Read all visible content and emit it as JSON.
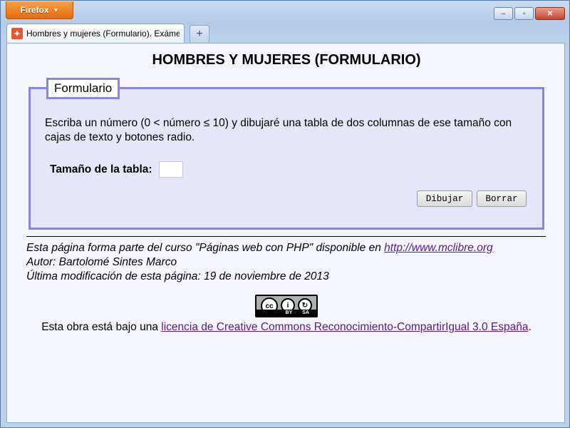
{
  "browser": {
    "menu_button": "Firefox",
    "tab_title": "Hombres y mujeres (Formulario). Exáme...",
    "new_tab_symbol": "+",
    "controls": {
      "minimize": "–",
      "maximize": "▫",
      "close": "✕"
    }
  },
  "page": {
    "title": "HOMBRES Y MUJERES (FORMULARIO)",
    "form": {
      "legend": "Formulario",
      "description": "Escriba un número (0 < número ≤ 10) y dibujaré una tabla de dos columnas de ese tamaño con cajas de texto y botones radio.",
      "size_label": "Tamaño de la tabla:",
      "size_value": "",
      "draw_button": "Dibujar",
      "reset_button": "Borrar"
    },
    "footer": {
      "course_text": "Esta página forma parte del curso \"Páginas web con PHP\" disponible en ",
      "course_link": "http://www.mclibre.org",
      "author": "Autor: Bartolomé Sintes Marco",
      "modified": "Última modificación de esta página: 19 de noviembre de 2013"
    },
    "license": {
      "badge_cc": "cc",
      "badge_by": "BY",
      "badge_sa": "SA",
      "prefix": "Esta obra está bajo una ",
      "link": "licencia de Creative Commons Reconocimiento-CompartirIgual 3.0 España",
      "suffix": "."
    }
  }
}
